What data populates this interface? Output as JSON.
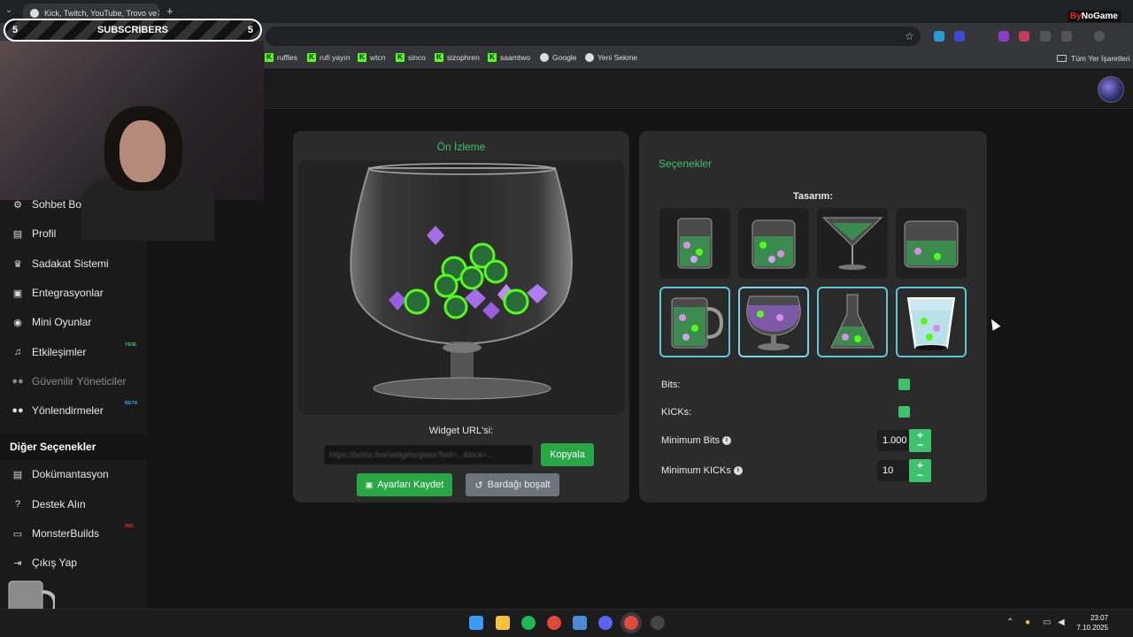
{
  "browser": {
    "tab_title": "Kick, Twitch, YouTube, Trovo ve",
    "tab_close": "✕",
    "new_tab": "+",
    "tabs_menu": "⌄",
    "bookmarks": [
      {
        "label": "ruffles",
        "icon": "kick-icon"
      },
      {
        "label": "rufi yayın",
        "icon": "kick-icon"
      },
      {
        "label": "wtcn",
        "icon": "kick-icon"
      },
      {
        "label": "sinco",
        "icon": "kick-icon"
      },
      {
        "label": "sizophren",
        "icon": "kick-icon"
      },
      {
        "label": "saamtwo",
        "icon": "kick-icon"
      },
      {
        "label": "Google",
        "icon": "google-icon"
      },
      {
        "label": "Yeni Sekme",
        "icon": "globe-icon"
      }
    ],
    "all_bookmarks": "Tüm Yer İşaretleri"
  },
  "overlay": {
    "subscribers_left": "5",
    "subscribers_label": "SUBSCRIBERS",
    "subscribers_right": "5",
    "brand_prefix": "By",
    "brand_main": "NoGame"
  },
  "sidebar": {
    "items": [
      {
        "label": "Sohbet Botu",
        "icon": "robot-icon",
        "badge": ""
      },
      {
        "label": "Profil",
        "icon": "id-card-icon",
        "badge": ""
      },
      {
        "label": "Sadakat Sistemi",
        "icon": "trophy-icon",
        "badge": ""
      },
      {
        "label": "Entegrasyonlar",
        "icon": "plug-icon",
        "badge": ""
      },
      {
        "label": "Mini Oyunlar",
        "icon": "gamepad-icon",
        "badge": ""
      },
      {
        "label": "Etkileşimler",
        "icon": "music-icon",
        "badge": "YENİ"
      },
      {
        "label": "Güvenilir Yöneticiler",
        "icon": "users-icon",
        "badge": ""
      },
      {
        "label": "Yönlendirmeler",
        "icon": "user-group-icon",
        "badge": "BETA"
      }
    ],
    "section_title": "Diğer Seçenekler",
    "other_items": [
      {
        "label": "Dokümantasyon",
        "icon": "scroll-icon",
        "badge": ""
      },
      {
        "label": "Destek Alın",
        "icon": "question-icon",
        "badge": ""
      },
      {
        "label": "MonsterBuilds",
        "icon": "laptop-icon",
        "badge": "İND."
      },
      {
        "label": "Çıkış Yap",
        "icon": "logout-icon",
        "badge": ""
      }
    ]
  },
  "preview": {
    "title": "Ön İzleme",
    "widget_url_label": "Widget URL'si:",
    "widget_url_value": "https://botrix.live/widgets/glass?bid=...&kick=...",
    "copy_button": "Kopyala",
    "save_button": "Ayarları Kaydet",
    "empty_button": "Bardağı boşalt"
  },
  "options": {
    "title": "Seçenekler",
    "design_label": "Tasarım:",
    "designs": [
      "tall-glass",
      "wide-tumbler",
      "martini-glass",
      "square-jar",
      "beer-mug",
      "brandy-snifter",
      "erlenmeyer-flask",
      "paper-cup"
    ],
    "selected_design": "brandy-snifter",
    "bits_label": "Bits:",
    "bits_checked": true,
    "kicks_label": "KICKs:",
    "kicks_checked": true,
    "min_bits_label": "Minimum Bits",
    "min_bits_value": "1.000",
    "min_kicks_label": "Minimum KICKs",
    "min_kicks_value": "10",
    "plus": "+",
    "minus": "−"
  },
  "taskbar": {
    "time": "23:07",
    "date": "7.10.2025"
  },
  "colors": {
    "accent_green": "#3cc36b",
    "button_green": "#28a745",
    "kick_green": "#53fc18",
    "selection_cyan": "#5ac8d8"
  }
}
